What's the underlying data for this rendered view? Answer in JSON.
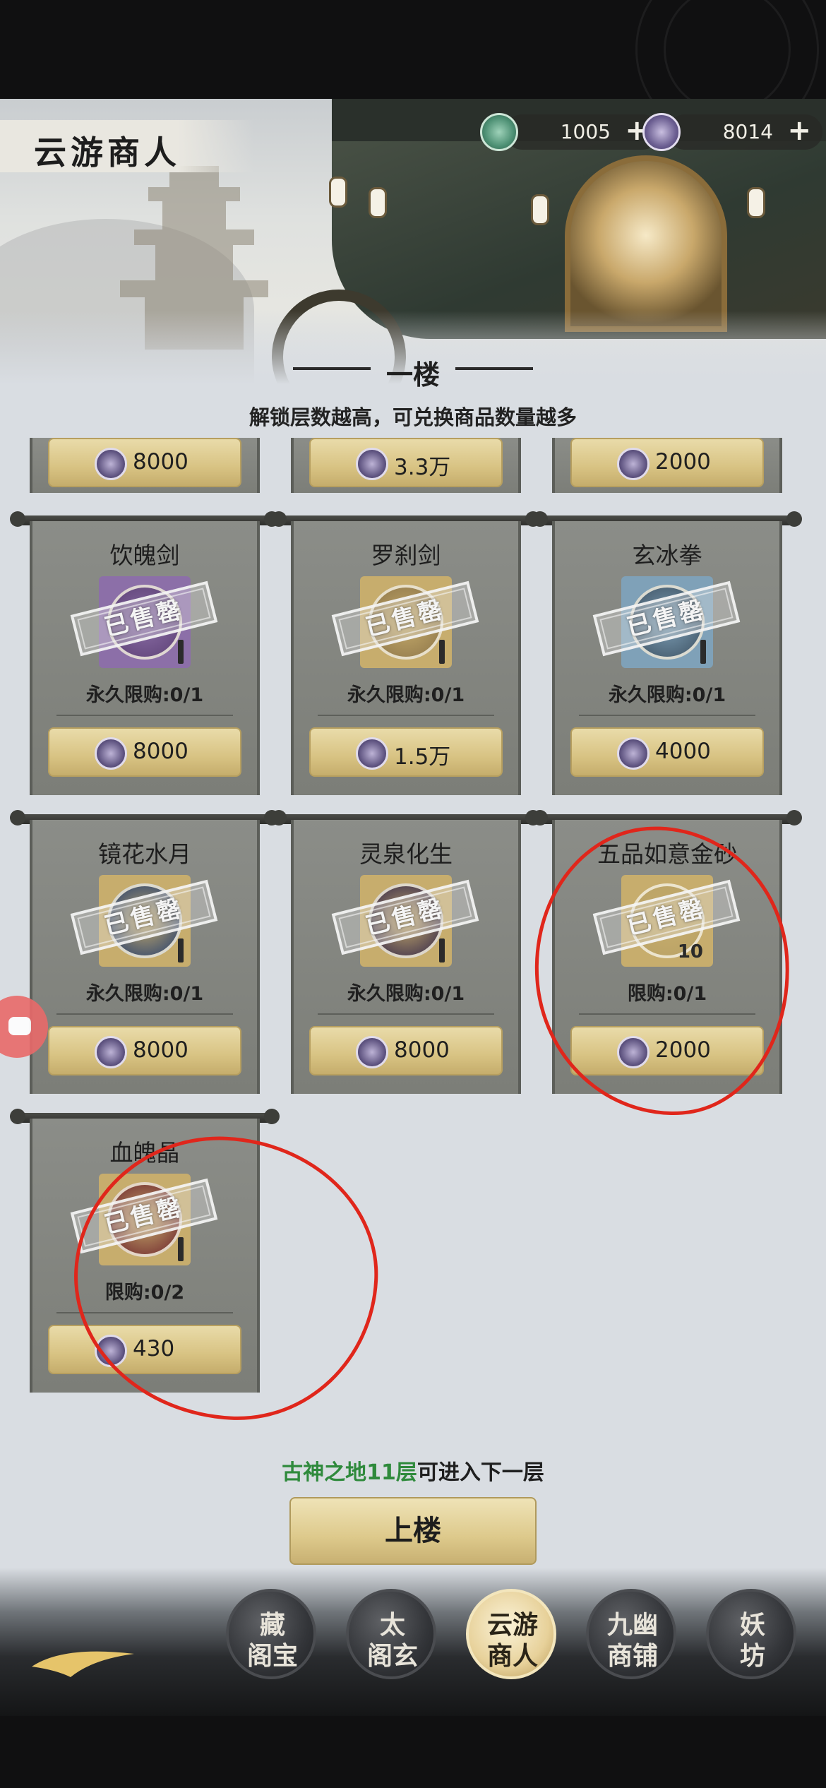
{
  "header": {
    "title": "云游商人",
    "floor_title": "一楼",
    "subtitle": "解锁层数越高，可兑换商品数量越多"
  },
  "currencies": [
    {
      "icon": "jade-currency-icon",
      "value": "1005",
      "plus": "+"
    },
    {
      "icon": "coin-currency-icon",
      "value": "8014",
      "plus": "+"
    }
  ],
  "partial_row_prices": [
    "8000",
    "3.3万",
    "2000"
  ],
  "items": [
    {
      "name": "饮魄剑",
      "limit": "永久限购:0/1",
      "price": "8000",
      "sold": "已售罄",
      "bg": "#8c6fa8",
      "orb": "#5b3f73"
    },
    {
      "name": "罗刹剑",
      "limit": "永久限购:0/1",
      "price": "1.5万",
      "sold": "已售罄",
      "bg": "#c7ad6d",
      "orb": "#8c7448"
    },
    {
      "name": "玄冰拳",
      "limit": "永久限购:0/1",
      "price": "4000",
      "sold": "已售罄",
      "bg": "#7fa1b8",
      "orb": "#3b4f60"
    },
    {
      "name": "镜花水月",
      "limit": "永久限购:0/1",
      "price": "8000",
      "sold": "已售罄",
      "bg": "#c7ad6d",
      "orb": "#1f3a6e"
    },
    {
      "name": "灵泉化生",
      "limit": "永久限购:0/1",
      "price": "8000",
      "sold": "已售罄",
      "bg": "#c7ad6d",
      "orb": "#2d2148"
    },
    {
      "name": "五品如意金砂",
      "limit": "限购:0/1",
      "price": "2000",
      "sold": "已售罄",
      "qty": "10",
      "bg": "#c7ad6d",
      "orb": "#b8a165"
    },
    {
      "name": "血魄晶",
      "limit": "限购:0/2",
      "price": "430",
      "sold": "已售罄",
      "bg": "#c7ad6d",
      "orb": "#6a1f2a"
    }
  ],
  "hint": {
    "green": "古神之地11层",
    "rest": "可进入下一层"
  },
  "up_button": "上楼",
  "nav": [
    {
      "l1": "藏",
      "l2": "阁宝",
      "active": false
    },
    {
      "l1": "太",
      "l2": "阁玄",
      "active": false
    },
    {
      "l1": "云游",
      "l2": "商人",
      "active": true
    },
    {
      "l1": "九幽",
      "l2": "商铺",
      "active": false
    },
    {
      "l1": "妖",
      "l2": "坊",
      "active": false
    }
  ]
}
